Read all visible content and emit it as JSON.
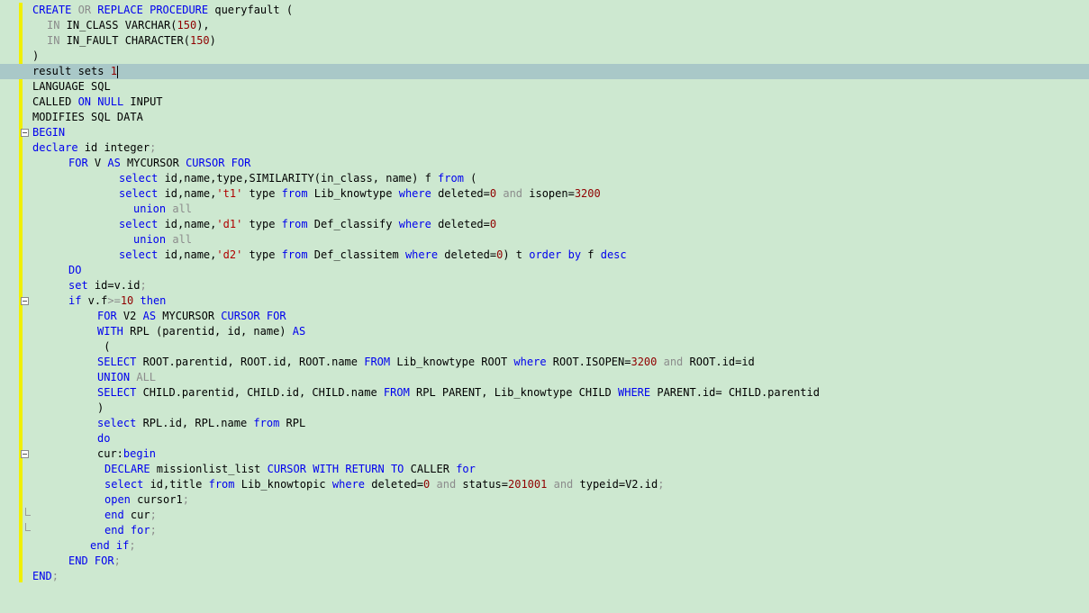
{
  "editor": {
    "language": "SQL",
    "current_line": 5,
    "lines": [
      {
        "n": 1,
        "indent": 0,
        "tokens": [
          [
            "CREATE",
            "kw"
          ],
          [
            " ",
            ""
          ],
          [
            "OR",
            "gr"
          ],
          [
            " ",
            ""
          ],
          [
            "REPLACE",
            "kw"
          ],
          [
            " ",
            ""
          ],
          [
            "PROCEDURE",
            "kw"
          ],
          [
            " queryfault (",
            ""
          ]
        ]
      },
      {
        "n": 2,
        "indent": 2,
        "tokens": [
          [
            "IN",
            "gr"
          ],
          [
            " IN_CLASS ",
            ""
          ],
          [
            "VARCHAR",
            ""
          ],
          [
            "(",
            ""
          ],
          [
            "150",
            "nm"
          ],
          [
            "),",
            ""
          ]
        ]
      },
      {
        "n": 3,
        "indent": 2,
        "tokens": [
          [
            "IN",
            "gr"
          ],
          [
            " IN_FAULT ",
            ""
          ],
          [
            "CHARACTER",
            ""
          ],
          [
            "(",
            ""
          ],
          [
            "150",
            "nm"
          ],
          [
            ")",
            ""
          ]
        ]
      },
      {
        "n": 4,
        "indent": 0,
        "tokens": [
          [
            ")",
            ""
          ]
        ]
      },
      {
        "n": 5,
        "indent": 0,
        "tokens": [
          [
            "result sets ",
            ""
          ],
          [
            "1",
            "nm"
          ]
        ],
        "caret": true
      },
      {
        "n": 6,
        "indent": 0,
        "tokens": [
          [
            "LANGUAGE SQL",
            ""
          ]
        ]
      },
      {
        "n": 7,
        "indent": 0,
        "tokens": [
          [
            "CALLED ",
            ""
          ],
          [
            "ON",
            "kw"
          ],
          [
            " ",
            ""
          ],
          [
            "NULL",
            "kw"
          ],
          [
            " INPUT",
            ""
          ]
        ]
      },
      {
        "n": 8,
        "indent": 0,
        "tokens": [
          [
            "MODIFIES SQL DATA",
            ""
          ]
        ]
      },
      {
        "n": 9,
        "indent": 0,
        "fold": "open",
        "tokens": [
          [
            "BEGIN",
            "kw"
          ]
        ]
      },
      {
        "n": 10,
        "indent": 0,
        "tokens": [
          [
            "declare",
            "kw"
          ],
          [
            " id ",
            ""
          ],
          [
            "integer",
            ""
          ],
          [
            ";",
            "gr"
          ]
        ]
      },
      {
        "n": 11,
        "indent": 5,
        "tokens": [
          [
            "FOR",
            "kw"
          ],
          [
            " V ",
            ""
          ],
          [
            "AS",
            "kw"
          ],
          [
            " MYCURSOR ",
            ""
          ],
          [
            "CURSOR",
            "kw"
          ],
          [
            " ",
            ""
          ],
          [
            "FOR",
            "kw"
          ]
        ]
      },
      {
        "n": 12,
        "indent": 12,
        "tokens": [
          [
            "select",
            "kw"
          ],
          [
            " id,name,type,SIMILARITY(in_class, name) f ",
            ""
          ],
          [
            "from",
            "kw"
          ],
          [
            " (",
            ""
          ]
        ]
      },
      {
        "n": 13,
        "indent": 12,
        "tokens": [
          [
            "select",
            "kw"
          ],
          [
            " id,name,",
            ""
          ],
          [
            "'t1'",
            "st"
          ],
          [
            " type ",
            ""
          ],
          [
            "from",
            "kw"
          ],
          [
            " Lib_knowtype ",
            ""
          ],
          [
            "where",
            "kw"
          ],
          [
            " deleted=",
            ""
          ],
          [
            "0",
            "nm"
          ],
          [
            " ",
            ""
          ],
          [
            "and",
            "gr"
          ],
          [
            " isopen=",
            ""
          ],
          [
            "3200",
            "nm"
          ]
        ]
      },
      {
        "n": 14,
        "indent": 14,
        "tokens": [
          [
            "union",
            "kw"
          ],
          [
            " ",
            ""
          ],
          [
            "all",
            "gr"
          ]
        ]
      },
      {
        "n": 15,
        "indent": 12,
        "tokens": [
          [
            "select",
            "kw"
          ],
          [
            " id,name,",
            ""
          ],
          [
            "'d1'",
            "st"
          ],
          [
            " type ",
            ""
          ],
          [
            "from",
            "kw"
          ],
          [
            " Def_classify ",
            ""
          ],
          [
            "where",
            "kw"
          ],
          [
            " deleted=",
            ""
          ],
          [
            "0",
            "nm"
          ]
        ]
      },
      {
        "n": 16,
        "indent": 14,
        "tokens": [
          [
            "union",
            "kw"
          ],
          [
            " ",
            ""
          ],
          [
            "all",
            "gr"
          ]
        ]
      },
      {
        "n": 17,
        "indent": 12,
        "tokens": [
          [
            "select",
            "kw"
          ],
          [
            " id,name,",
            ""
          ],
          [
            "'d2'",
            "st"
          ],
          [
            " type ",
            ""
          ],
          [
            "from",
            "kw"
          ],
          [
            " Def_classitem ",
            ""
          ],
          [
            "where",
            "kw"
          ],
          [
            " deleted=",
            ""
          ],
          [
            "0",
            "nm"
          ],
          [
            ") t ",
            ""
          ],
          [
            "order",
            "kw"
          ],
          [
            " ",
            ""
          ],
          [
            "by",
            "kw"
          ],
          [
            " f ",
            ""
          ],
          [
            "desc",
            "kw"
          ]
        ]
      },
      {
        "n": 18,
        "indent": 5,
        "tokens": [
          [
            "DO",
            "kw"
          ]
        ]
      },
      {
        "n": 19,
        "indent": 5,
        "tokens": [
          [
            "set",
            "kw"
          ],
          [
            " id=v.id",
            ""
          ],
          [
            ";",
            "gr"
          ]
        ]
      },
      {
        "n": 20,
        "indent": 5,
        "fold": "open",
        "tokens": [
          [
            "if",
            "kw"
          ],
          [
            " v.f",
            ""
          ],
          [
            ">=",
            "gr"
          ],
          [
            "10",
            "nm"
          ],
          [
            " ",
            ""
          ],
          [
            "then",
            "kw"
          ]
        ]
      },
      {
        "n": 21,
        "indent": 9,
        "tokens": [
          [
            "FOR",
            "kw"
          ],
          [
            " V2 ",
            ""
          ],
          [
            "AS",
            "kw"
          ],
          [
            " MYCURSOR ",
            ""
          ],
          [
            "CURSOR",
            "kw"
          ],
          [
            " ",
            ""
          ],
          [
            "FOR",
            "kw"
          ]
        ]
      },
      {
        "n": 22,
        "indent": 9,
        "tokens": [
          [
            "WITH",
            "kw"
          ],
          [
            " RPL (parentid, id, name) ",
            ""
          ],
          [
            "AS",
            "kw"
          ]
        ]
      },
      {
        "n": 23,
        "indent": 9,
        "tokens": [
          [
            " (",
            ""
          ]
        ]
      },
      {
        "n": 24,
        "indent": 9,
        "tokens": [
          [
            "SELECT",
            "kw"
          ],
          [
            " ROOT.parentid, ROOT.id, ROOT.name ",
            ""
          ],
          [
            "FROM",
            "kw"
          ],
          [
            " Lib_knowtype ROOT ",
            ""
          ],
          [
            "where",
            "kw"
          ],
          [
            " ROOT.ISOPEN=",
            ""
          ],
          [
            "3200",
            "nm"
          ],
          [
            " ",
            ""
          ],
          [
            "and",
            "gr"
          ],
          [
            " ROOT.id=id",
            ""
          ]
        ]
      },
      {
        "n": 25,
        "indent": 9,
        "tokens": [
          [
            "UNION",
            "kw"
          ],
          [
            " ",
            ""
          ],
          [
            "ALL",
            "gr"
          ]
        ]
      },
      {
        "n": 26,
        "indent": 9,
        "tokens": [
          [
            "SELECT",
            "kw"
          ],
          [
            " CHILD.parentid, CHILD.id, CHILD.name ",
            ""
          ],
          [
            "FROM",
            "kw"
          ],
          [
            " RPL PARENT, Lib_knowtype CHILD ",
            ""
          ],
          [
            "WHERE",
            "kw"
          ],
          [
            " PARENT.id= CHILD.parentid",
            ""
          ]
        ]
      },
      {
        "n": 27,
        "indent": 9,
        "tokens": [
          [
            ")",
            ""
          ]
        ]
      },
      {
        "n": 28,
        "indent": 9,
        "tokens": [
          [
            "select",
            "kw"
          ],
          [
            " RPL.id, RPL.name ",
            ""
          ],
          [
            "from",
            "kw"
          ],
          [
            " RPL",
            ""
          ]
        ]
      },
      {
        "n": 29,
        "indent": 9,
        "tokens": [
          [
            "do",
            "kw"
          ]
        ]
      },
      {
        "n": 30,
        "indent": 9,
        "fold": "open",
        "tokens": [
          [
            "cur:",
            ""
          ],
          [
            "begin",
            "kw"
          ]
        ]
      },
      {
        "n": 31,
        "indent": 10,
        "tokens": [
          [
            "DECLARE",
            "kw"
          ],
          [
            " missionlist_list ",
            ""
          ],
          [
            "CURSOR",
            "kw"
          ],
          [
            " ",
            ""
          ],
          [
            "WITH",
            "kw"
          ],
          [
            " ",
            ""
          ],
          [
            "RETURN",
            "kw"
          ],
          [
            " ",
            ""
          ],
          [
            "TO",
            "kw"
          ],
          [
            " CALLER ",
            ""
          ],
          [
            "for",
            "kw"
          ]
        ]
      },
      {
        "n": 32,
        "indent": 10,
        "tokens": [
          [
            "select",
            "kw"
          ],
          [
            " id,title ",
            ""
          ],
          [
            "from",
            "kw"
          ],
          [
            " Lib_knowtopic ",
            ""
          ],
          [
            "where",
            "kw"
          ],
          [
            " deleted=",
            ""
          ],
          [
            "0",
            "nm"
          ],
          [
            " ",
            ""
          ],
          [
            "and",
            "gr"
          ],
          [
            " status=",
            ""
          ],
          [
            "201001",
            "nm"
          ],
          [
            " ",
            ""
          ],
          [
            "and",
            "gr"
          ],
          [
            " typeid=V2.id",
            ""
          ],
          [
            ";",
            "gr"
          ]
        ]
      },
      {
        "n": 33,
        "indent": 10,
        "tokens": [
          [
            "open",
            "kw"
          ],
          [
            " cursor1",
            ""
          ],
          [
            ";",
            "gr"
          ]
        ]
      },
      {
        "n": 34,
        "indent": 10,
        "fold": "end",
        "tokens": [
          [
            "end",
            "kw"
          ],
          [
            " cur",
            ""
          ],
          [
            ";",
            "gr"
          ]
        ]
      },
      {
        "n": 35,
        "indent": 10,
        "fold": "end",
        "tokens": [
          [
            "end",
            "kw"
          ],
          [
            " ",
            ""
          ],
          [
            "for",
            "kw"
          ],
          [
            ";",
            "gr"
          ]
        ]
      },
      {
        "n": 36,
        "indent": 8,
        "tokens": [
          [
            "end",
            "kw"
          ],
          [
            " ",
            ""
          ],
          [
            "if",
            "kw"
          ],
          [
            ";",
            "gr"
          ]
        ]
      },
      {
        "n": 37,
        "indent": 5,
        "tokens": [
          [
            "END",
            "kw"
          ],
          [
            " ",
            ""
          ],
          [
            "FOR",
            "kw"
          ],
          [
            ";",
            "gr"
          ]
        ]
      },
      {
        "n": 38,
        "indent": 0,
        "tokens": [
          [
            "END",
            "kw"
          ],
          [
            ";",
            "gr"
          ]
        ]
      }
    ]
  }
}
